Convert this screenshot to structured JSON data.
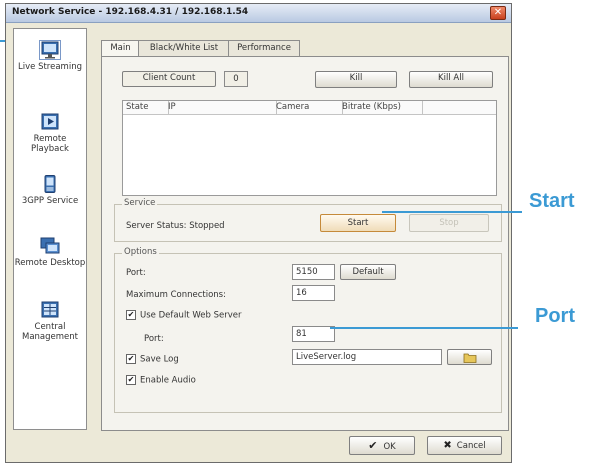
{
  "window": {
    "title": "Network Service - 192.168.4.31 / 192.168.1.54",
    "close_glyph": "✕"
  },
  "sidebar": {
    "items": [
      {
        "label": "Live Streaming",
        "icon": "live-streaming-icon"
      },
      {
        "label": "Remote Playback",
        "icon": "remote-playback-icon"
      },
      {
        "label": "3GPP Service",
        "icon": "3gpp-service-icon"
      },
      {
        "label": "Remote Desktop",
        "icon": "remote-desktop-icon"
      },
      {
        "label": "Central Management",
        "icon": "central-management-icon"
      }
    ]
  },
  "tabs": [
    {
      "label": "Main"
    },
    {
      "label": "Black/White List"
    },
    {
      "label": "Performance"
    }
  ],
  "main": {
    "client_count_label": "Client Count",
    "client_count_value": "0",
    "kill_label": "Kill",
    "kill_all_label": "Kill All",
    "columns": [
      "State",
      "IP",
      "Camera",
      "Bitrate (Kbps)"
    ]
  },
  "service": {
    "title": "Service",
    "status": "Server Status: Stopped",
    "start_label": "Start",
    "stop_label": "Stop"
  },
  "options": {
    "title": "Options",
    "port_label": "Port:",
    "port_value": "5150",
    "default_label": "Default",
    "max_conn_label": "Maximum Connections:",
    "max_conn_value": "16",
    "use_web_server_label": "Use Default Web Server",
    "web_port_label": "Port:",
    "web_port_value": "81",
    "save_log_label": "Save Log",
    "log_file_value": "LiveServer.log",
    "enable_audio_label": "Enable Audio",
    "check_glyph": "✔"
  },
  "footer": {
    "ok_label": "OK",
    "cancel_label": "Cancel",
    "ok_glyph": "✔",
    "cancel_glyph": "✖"
  },
  "callouts": {
    "start": "Start",
    "port": "Port"
  },
  "colors": {
    "callout": "#3b9ad4",
    "title_bar": "#c9d6ea",
    "window_bg": "#ece9d8"
  }
}
